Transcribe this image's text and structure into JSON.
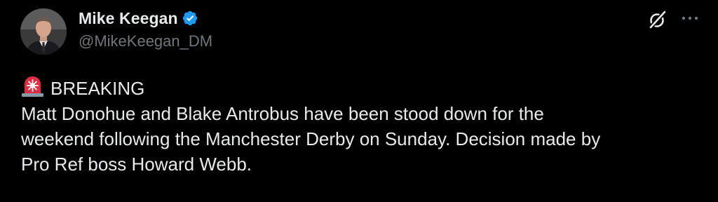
{
  "author": {
    "display_name": "Mike Keegan",
    "handle": "@MikeKeegan_DM",
    "verified": true
  },
  "icons": {
    "verified": "verified-badge-icon",
    "grok": "grok-icon",
    "more": "more-horizontal-icon",
    "siren": "police-light-emoji-icon"
  },
  "tweet": {
    "headline": "BREAKING",
    "lines": [
      "Matt Donohue and Blake Antrobus have been stood down for the",
      "weekend following the Manchester Derby on Sunday. Decision made by",
      "Pro Ref boss Howard Webb."
    ]
  },
  "colors": {
    "background": "#000000",
    "text": "#e7e9ea",
    "secondary": "#71767b",
    "verified": "#1d9bf0"
  }
}
